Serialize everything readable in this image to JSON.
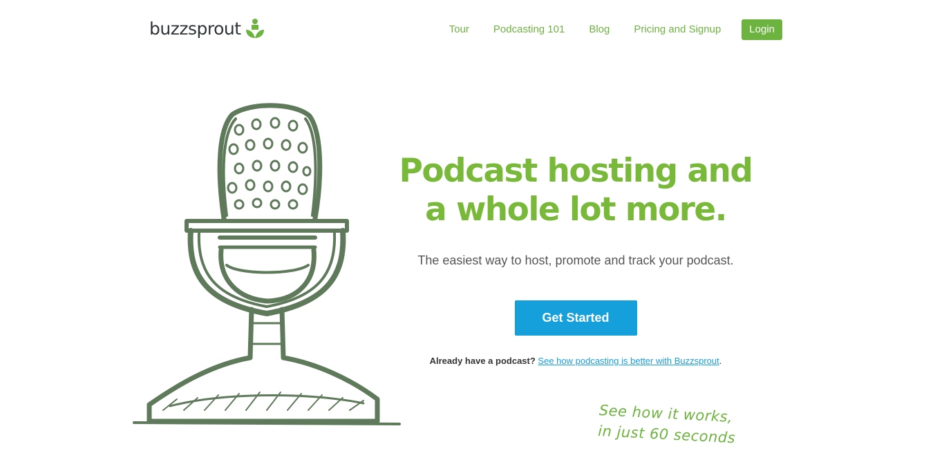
{
  "header": {
    "logo_text": "buzzsprout",
    "nav": [
      "Tour",
      "Podcasting 101",
      "Blog",
      "Pricing and Signup"
    ],
    "login_label": "Login"
  },
  "hero": {
    "headline_line1": "Podcast hosting and",
    "headline_line2": "a whole lot more.",
    "subline": "The easiest way to host, promote and track your podcast.",
    "cta_label": "Get Started",
    "already_prefix": "Already have a podcast?",
    "already_link": "See how podcasting is better with Buzzsprout",
    "already_suffix": "."
  },
  "handnote": {
    "line1": "See how it works,",
    "line2": "in just 60 seconds"
  },
  "colors": {
    "brand_green": "#6db33f",
    "headline_green": "#79b939",
    "cta_blue": "#159fdb",
    "mic_green": "#5e7a5a"
  },
  "icons": {
    "logo": "sprout-person-icon",
    "illustration": "microphone-sketch"
  }
}
